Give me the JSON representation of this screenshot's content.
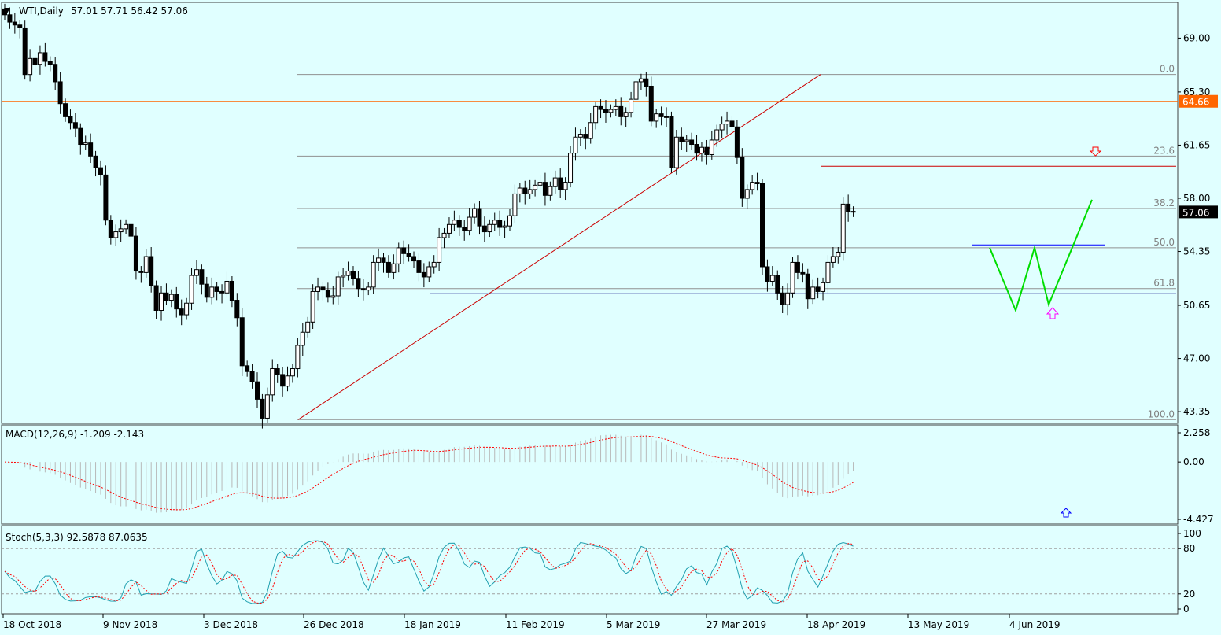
{
  "chart_data": [
    {
      "type": "candlestick",
      "symbol": "WTI,Daily",
      "ohlc_header": "57.01 57.71 56.42 57.06",
      "yaxis_ticks": [
        "69.00",
        "65.30",
        "61.65",
        "58.00",
        "54.35",
        "50.65",
        "47.00",
        "43.35"
      ],
      "xaxis_labels": [
        "18 Oct 2018",
        "9 Nov 2018",
        "3 Dec 2018",
        "26 Dec 2018",
        "18 Jan 2019",
        "11 Feb 2019",
        "5 Mar 2019",
        "27 Mar 2019",
        "18 Apr 2019",
        "13 May 2019",
        "4 Jun 2019"
      ],
      "ylim": [
        42.6,
        71.4
      ],
      "horizontal_line_price": "64.66",
      "current_price": "57.06",
      "fib_levels": [
        {
          "label": "0.0",
          "price": 66.5
        },
        {
          "label": "23.6",
          "price": 60.9
        },
        {
          "label": "38.2",
          "price": 57.3
        },
        {
          "label": "50.0",
          "price": 54.6
        },
        {
          "label": "61.8",
          "price": 51.8
        },
        {
          "label": "100.0",
          "price": 42.8
        }
      ],
      "closes": [
        70.6,
        70.1,
        69.9,
        69.7,
        66.5,
        67.6,
        67.2,
        68.0,
        67.4,
        67.2,
        66.0,
        64.5,
        63.6,
        63.2,
        62.8,
        61.7,
        61.8,
        60.9,
        60.1,
        59.6,
        56.5,
        55.3,
        55.7,
        55.9,
        56.2,
        55.4,
        53.0,
        52.9,
        54.0,
        52.0,
        50.3,
        51.5,
        51.0,
        51.4,
        50.4,
        50.0,
        50.8,
        52.7,
        53.1,
        52.1,
        51.2,
        51.9,
        51.6,
        51.5,
        52.3,
        51.0,
        49.8,
        46.5,
        46.1,
        45.4,
        44.2,
        42.9,
        44.5,
        46.3,
        45.9,
        45.1,
        45.8,
        46.3,
        47.9,
        48.8,
        49.5,
        51.6,
        51.9,
        51.7,
        51.2,
        51.3,
        52.6,
        52.7,
        53.0,
        52.5,
        51.8,
        51.7,
        51.9,
        53.6,
        53.9,
        53.6,
        52.9,
        53.5,
        54.6,
        54.2,
        54.0,
        53.7,
        52.9,
        52.6,
        53.3,
        53.6,
        55.3,
        55.6,
        56.2,
        56.5,
        56.0,
        55.8,
        56.7,
        57.3,
        56.1,
        55.7,
        56.2,
        56.5,
        56.0,
        56.1,
        56.8,
        58.3,
        58.7,
        58.3,
        58.6,
        58.9,
        59.1,
        58.2,
        58.8,
        59.4,
        58.6,
        59.1,
        61.1,
        62.2,
        62.4,
        62.1,
        63.2,
        64.3,
        64.1,
        63.9,
        64.1,
        64.3,
        63.6,
        63.9,
        64.8,
        66.0,
        66.2,
        65.7,
        63.3,
        63.8,
        63.6,
        63.6,
        60.1,
        62.2,
        61.9,
        62.0,
        61.7,
        61.1,
        61.5,
        61.0,
        62.0,
        62.7,
        63.1,
        63.3,
        62.9,
        60.8,
        58.0,
        58.6,
        59.1,
        59.0,
        53.3,
        52.3,
        52.7,
        51.5,
        50.7,
        51.5,
        53.6,
        52.9,
        52.8,
        51.1,
        51.9,
        51.6,
        52.2,
        53.6,
        54.0,
        54.3,
        57.6,
        57.1,
        57.06
      ],
      "macd_header": "MACD(12,26,9) -1.209 -2.143",
      "macd_ticks": [
        "2.258",
        "0.00",
        "-4.427"
      ],
      "macd_ylim": [
        -4.427,
        2.258
      ],
      "stoch_header": "Stoch(5,3,3) 92.5878 87.0635",
      "stoch_ticks": [
        "100",
        "80",
        "20",
        "0"
      ],
      "stoch_ylim": [
        0,
        100
      ]
    }
  ]
}
